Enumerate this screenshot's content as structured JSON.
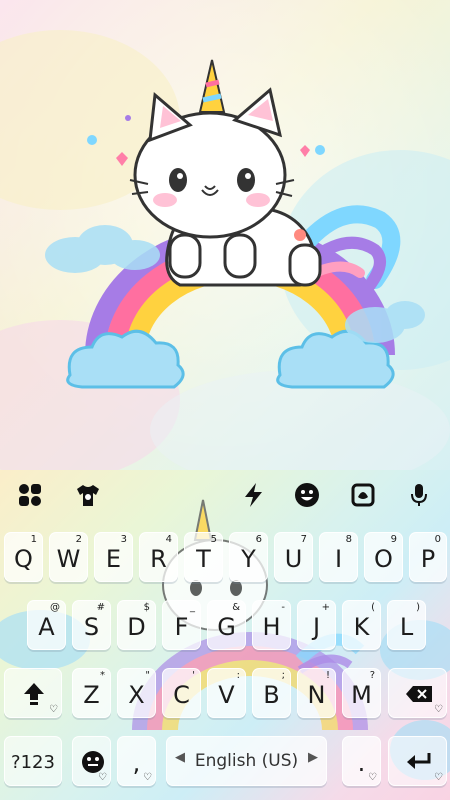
{
  "colors": {
    "key_text": "#1d1d1d",
    "icon": "#111111",
    "accent_pink": "#ff7fa8",
    "rainbow": [
      "#a67ce6",
      "#ff6fa0",
      "#ffd23f",
      "#7fd7ff"
    ]
  },
  "toolbar": {
    "icons": [
      "apps-icon",
      "theme-shirt-icon",
      "lightning-icon",
      "emoji-icon",
      "sticker-icon",
      "microphone-icon"
    ]
  },
  "rows": {
    "row1": [
      {
        "label": "Q",
        "hint": "1"
      },
      {
        "label": "W",
        "hint": "2"
      },
      {
        "label": "E",
        "hint": "3"
      },
      {
        "label": "R",
        "hint": "4"
      },
      {
        "label": "T",
        "hint": "5"
      },
      {
        "label": "Y",
        "hint": "6"
      },
      {
        "label": "U",
        "hint": "7"
      },
      {
        "label": "I",
        "hint": "8"
      },
      {
        "label": "O",
        "hint": "9"
      },
      {
        "label": "P",
        "hint": "0"
      }
    ],
    "row2": [
      {
        "label": "A",
        "hint": "@"
      },
      {
        "label": "S",
        "hint": "#"
      },
      {
        "label": "D",
        "hint": "$"
      },
      {
        "label": "F",
        "hint": "_"
      },
      {
        "label": "G",
        "hint": "&"
      },
      {
        "label": "H",
        "hint": "-"
      },
      {
        "label": "J",
        "hint": "+"
      },
      {
        "label": "K",
        "hint": "("
      },
      {
        "label": "L",
        "hint": ")"
      }
    ],
    "row3": [
      {
        "label": "Z",
        "hint": "*"
      },
      {
        "label": "X",
        "hint": "\""
      },
      {
        "label": "C",
        "hint": "'"
      },
      {
        "label": "V",
        "hint": ":"
      },
      {
        "label": "B",
        "hint": ";"
      },
      {
        "label": "N",
        "hint": "!"
      },
      {
        "label": "M",
        "hint": "?"
      }
    ]
  },
  "bottom": {
    "symbols_label": "?123",
    "comma_label": ",",
    "space_label": "English (US)",
    "period_label": ".",
    "heart": "♡"
  }
}
